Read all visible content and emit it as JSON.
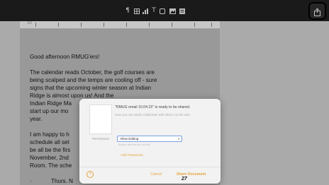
{
  "toolbar": {
    "icons": [
      "paragraph-icon",
      "table-icon",
      "chart-icon",
      "text-icon",
      "shape-icon",
      "media-icon",
      "comment-icon"
    ],
    "share_icon": "share-icon"
  },
  "ruler": {
    "labels": [
      "1/2",
      "1",
      "2",
      "3",
      "4",
      "5",
      "6",
      "7"
    ]
  },
  "document": {
    "greeting": "Good afternoon RMUG'ers!",
    "lines": [
      "The calendar reads October, the golf courses are",
      "being scalped and the temps are cooling off - sure",
      "signs that the upcoming winter season at Indian",
      "Ridge is almost upon us! And the",
      "Indian Ridge Ma",
      "start up our mo",
      "year."
    ],
    "lines2": [
      "I am happy to h",
      "schedule all set",
      "be all be the firs",
      "November, 2nd",
      "Room. The sche"
    ],
    "bullet": "Thurs. N"
  },
  "dialog": {
    "title": "\"RMUG email 10.04.15\" is ready to be shared.",
    "subtitle": "Now you can easily collaborate with others on the web.",
    "permissions_label": "Permissions",
    "permissions_value": "Allow Editing",
    "permissions_note": "Anyone with the link can edit",
    "add_password": "Add Password...",
    "help": "?",
    "cancel": "Cancel",
    "share": "Share Document"
  },
  "page_number": "27"
}
